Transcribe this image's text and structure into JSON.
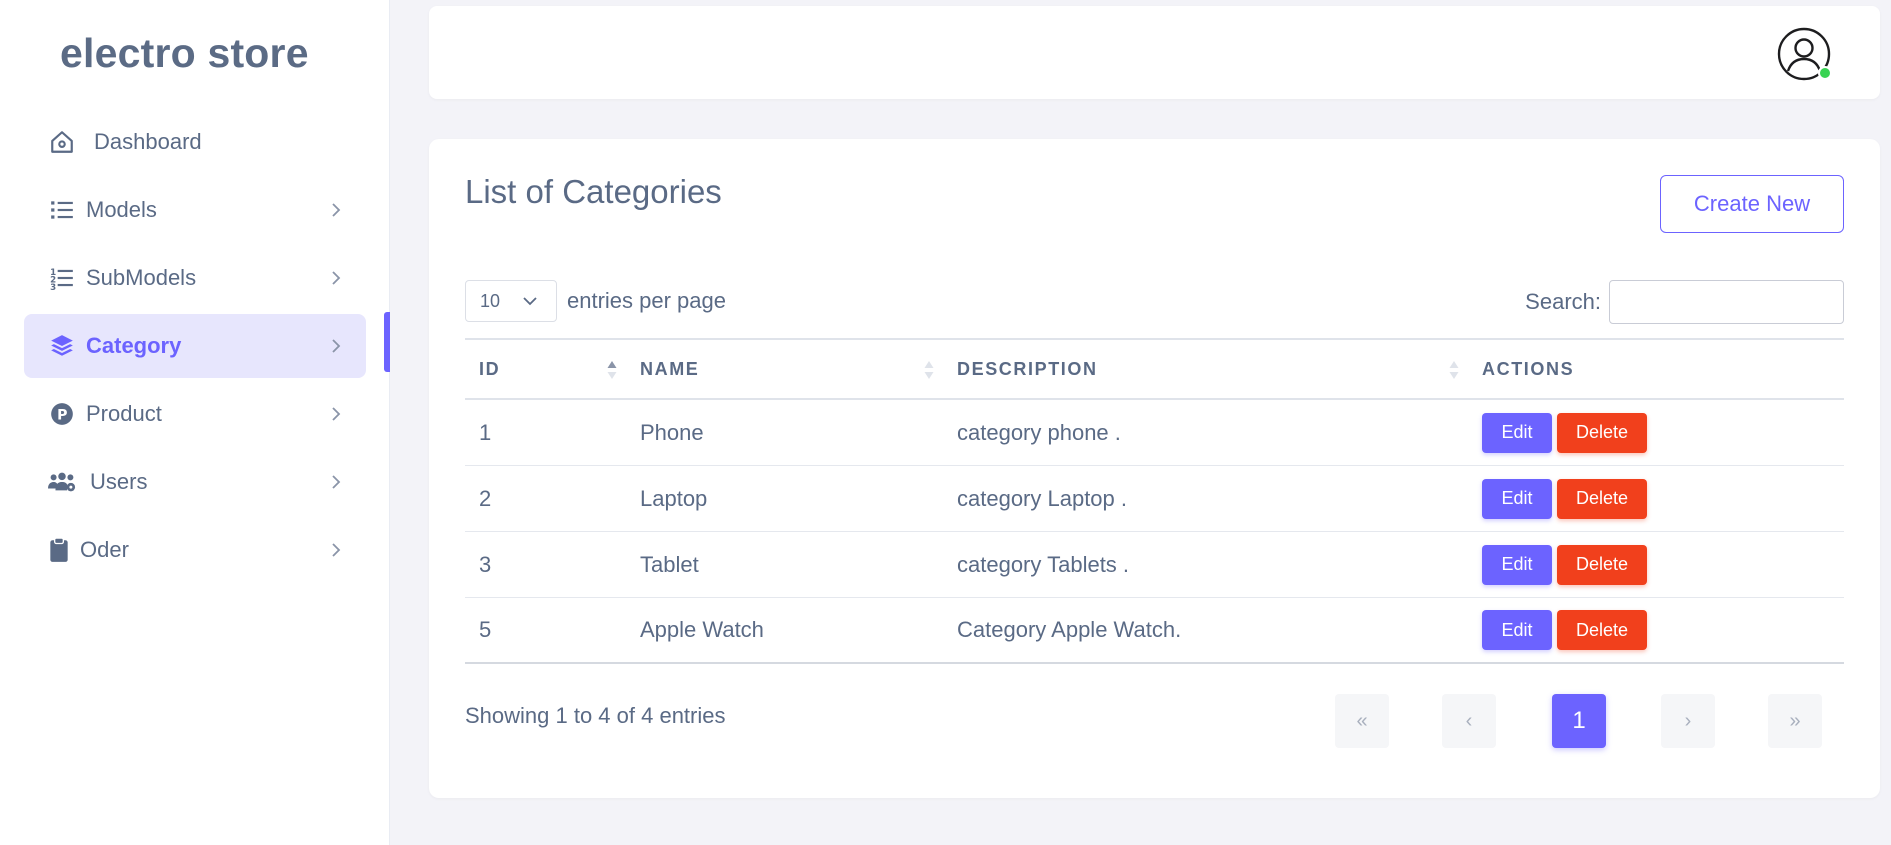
{
  "brand": "electro store",
  "sidebar": {
    "items": [
      {
        "label": "Dashboard",
        "icon": "home-icon",
        "active": false,
        "has_chevron": false
      },
      {
        "label": "Models",
        "icon": "list-icon",
        "active": false,
        "has_chevron": true
      },
      {
        "label": "SubModels",
        "icon": "ordered-list-icon",
        "active": false,
        "has_chevron": true
      },
      {
        "label": "Category",
        "icon": "layers-icon",
        "active": true,
        "has_chevron": true
      },
      {
        "label": "Product",
        "icon": "product-p-icon",
        "active": false,
        "has_chevron": true
      },
      {
        "label": "Users",
        "icon": "users-gear-icon",
        "active": false,
        "has_chevron": true
      },
      {
        "label": "Oder",
        "icon": "clipboard-icon",
        "active": false,
        "has_chevron": true
      }
    ]
  },
  "header": {
    "avatar_icon": "user-avatar-icon",
    "status": "online"
  },
  "main": {
    "title": "List of Categories",
    "create_label": "Create New",
    "entries_value": "10",
    "entries_label": "entries per page",
    "search_label": "Search:",
    "search_value": "",
    "columns": [
      "ID",
      "NAME",
      "DESCRIPTION",
      "ACTIONS"
    ],
    "rows": [
      {
        "id": "1",
        "name": "Phone",
        "description": "category phone ."
      },
      {
        "id": "2",
        "name": "Laptop",
        "description": "category Laptop ."
      },
      {
        "id": "3",
        "name": "Tablet",
        "description": "category Tablets ."
      },
      {
        "id": "5",
        "name": "Apple Watch",
        "description": "Category Apple Watch."
      }
    ],
    "edit_label": "Edit",
    "delete_label": "Delete",
    "showing": "Showing 1 to 4 of 4 entries",
    "pagination": {
      "first": "«",
      "prev": "‹",
      "current": "1",
      "next": "›",
      "last": "»"
    }
  },
  "colors": {
    "accent": "#6c63ff",
    "danger": "#f1401c",
    "text": "#5a6a85",
    "active_bg": "#e7e6fd",
    "online": "#39d353"
  }
}
